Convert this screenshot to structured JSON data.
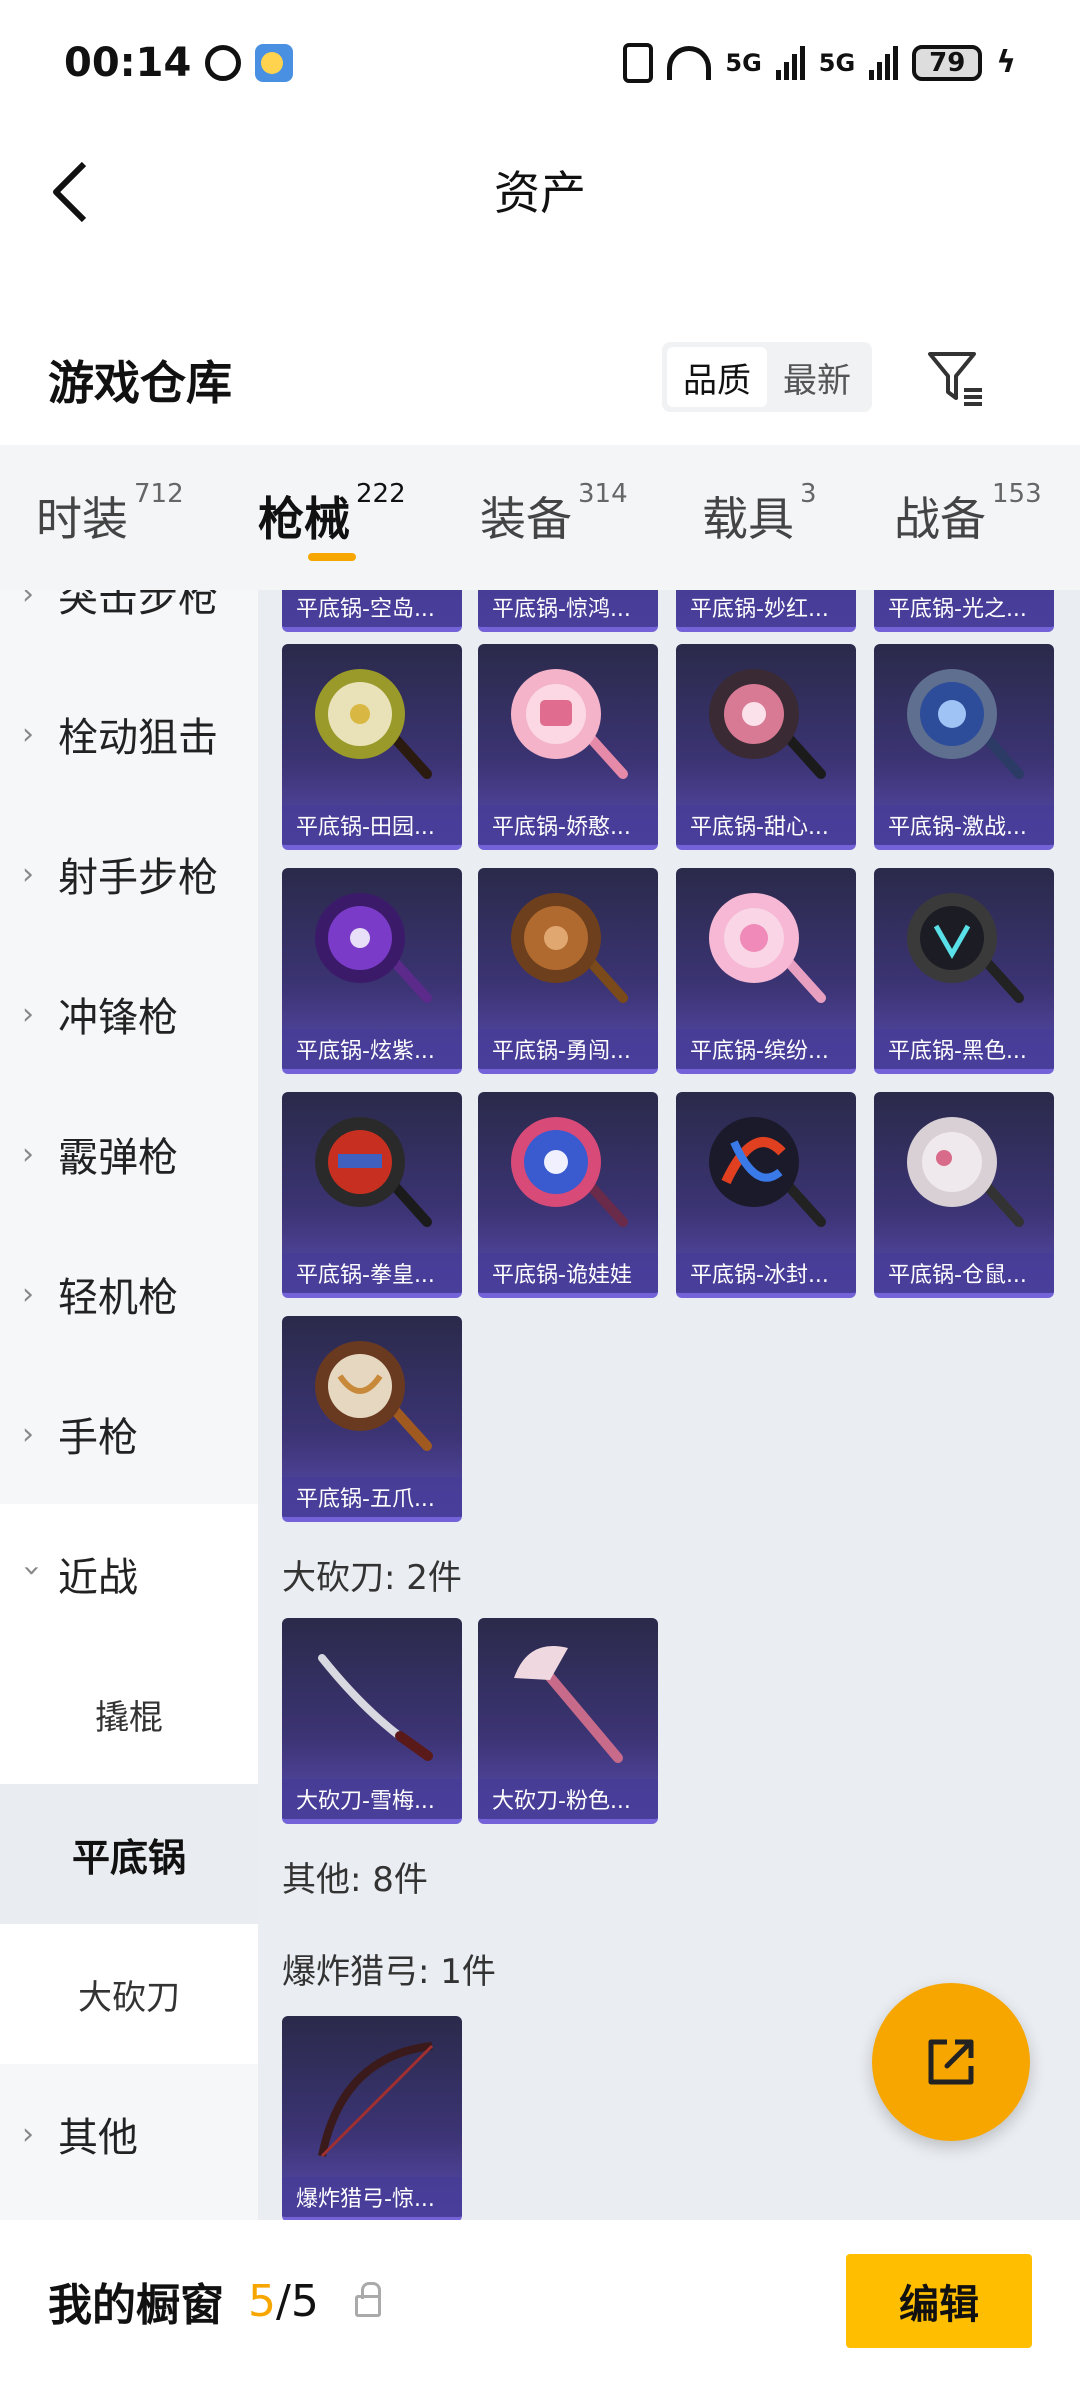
{
  "status_bar": {
    "time": "00:14",
    "battery": "79",
    "net1": "5G",
    "net2": "5G"
  },
  "header": {
    "title": "资产"
  },
  "warehouse": {
    "title": "游戏仓库",
    "sort_options": [
      "品质",
      "最新"
    ]
  },
  "tabs": [
    {
      "label": "时装",
      "count": "712"
    },
    {
      "label": "枪械",
      "count": "222"
    },
    {
      "label": "装备",
      "count": "314"
    },
    {
      "label": "载具",
      "count": "3"
    },
    {
      "label": "战备",
      "count": "153"
    }
  ],
  "sidebar": {
    "items": [
      "突击步枪",
      "栓动狙击",
      "射手步枪",
      "冲锋枪",
      "霰弹枪",
      "轻机枪",
      "手枪",
      "近战"
    ],
    "sub_items": [
      "撬棍",
      "平底锅",
      "大砍刀"
    ],
    "last_item": "其他"
  },
  "content": {
    "top_partial": [
      "平底锅-空岛...",
      "平底锅-惊鸿...",
      "平底锅-妙红...",
      "平底锅-光之..."
    ],
    "pans": [
      "平底锅-田园...",
      "平底锅-娇憨...",
      "平底锅-甜心...",
      "平底锅-激战...",
      "平底锅-炫紫...",
      "平底锅-勇闯...",
      "平底锅-缤纷...",
      "平底锅-黑色...",
      "平底锅-拳皇...",
      "平底锅-诡娃娃",
      "平底锅-冰封...",
      "平底锅-仓鼠...",
      "平底锅-五爪..."
    ],
    "machete_header": "大砍刀: 2件",
    "machetes": [
      "大砍刀-雪梅...",
      "大砍刀-粉色..."
    ],
    "other_header": "其他: 8件",
    "bow_header": "爆炸猎弓: 1件",
    "bows": [
      "爆炸猎弓-惊..."
    ]
  },
  "bottom_bar": {
    "label": "我的橱窗",
    "current": "5",
    "separator": "/",
    "total": "5",
    "edit_label": "编辑"
  },
  "colors": {
    "accent": "#f7a600",
    "edit_button": "#ffbf00",
    "card": "#3c3475"
  }
}
